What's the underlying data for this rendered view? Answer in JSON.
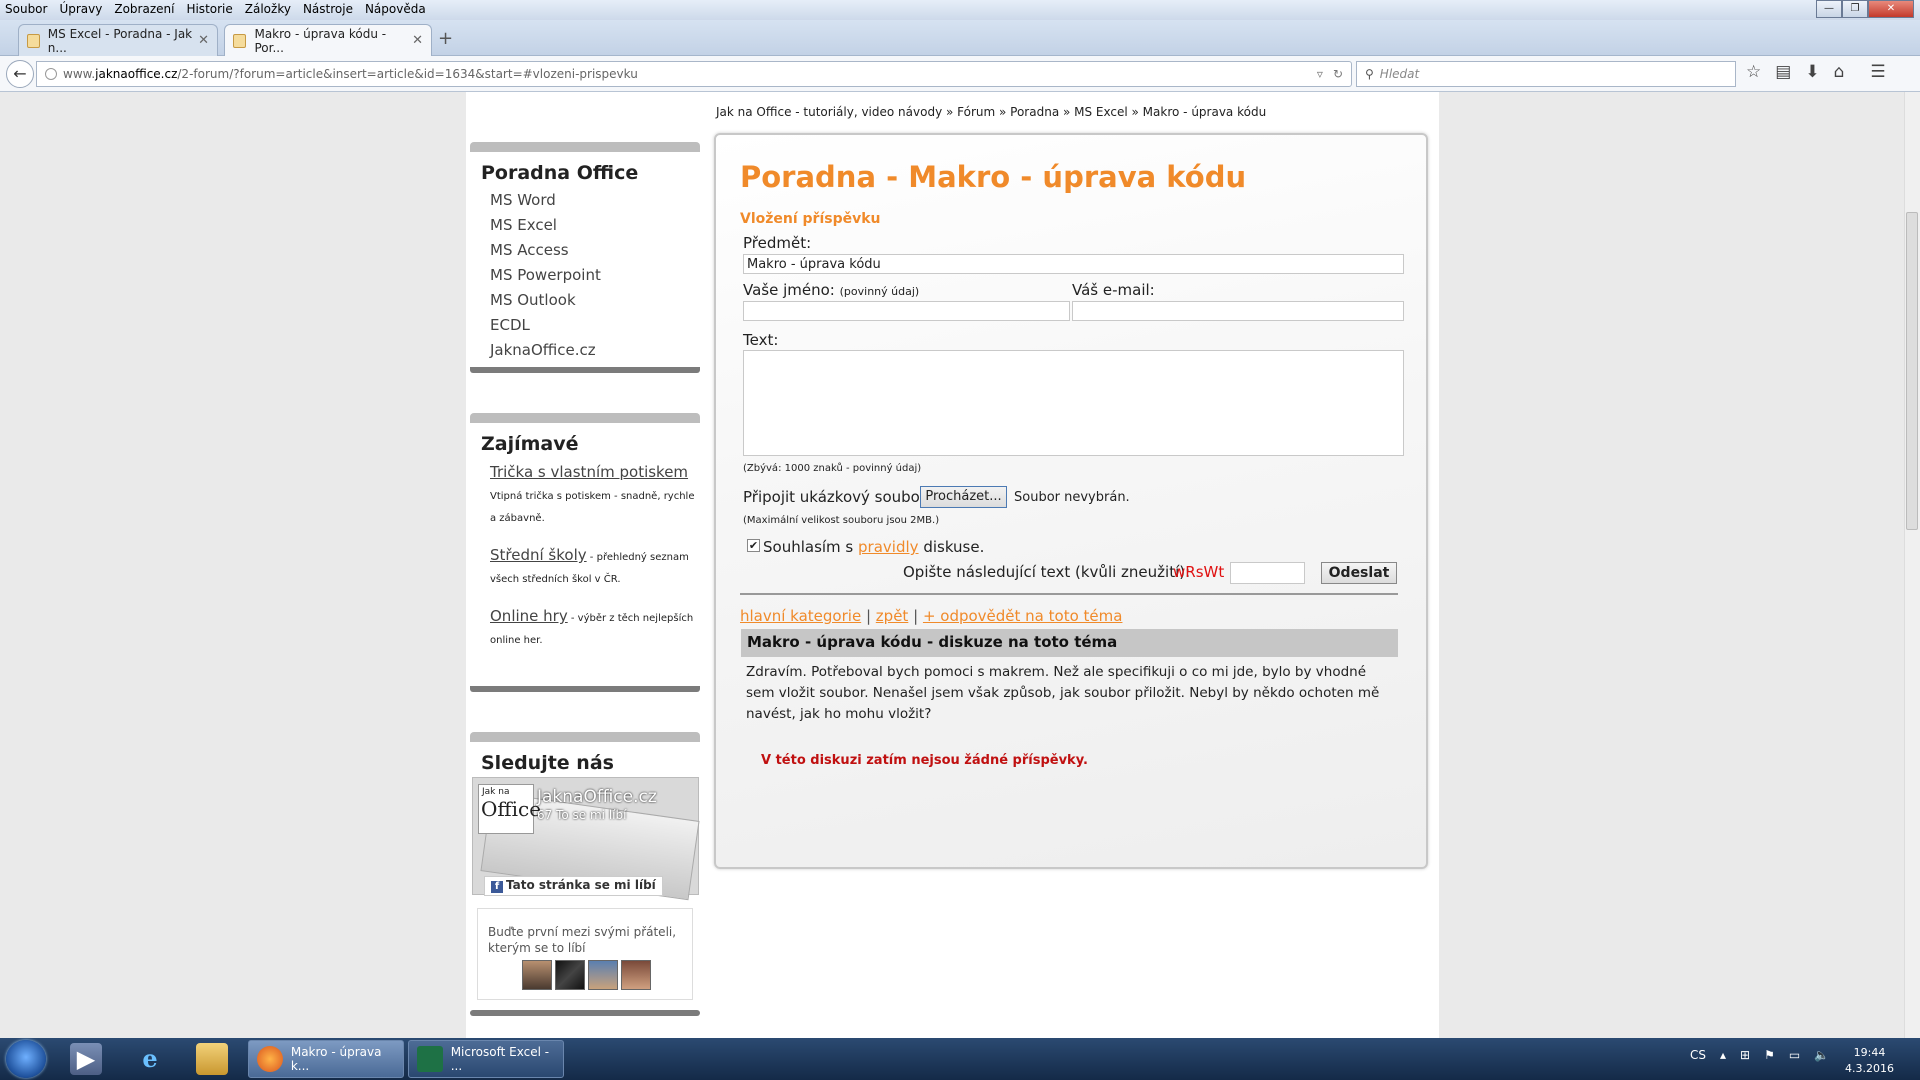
{
  "menu": [
    "Soubor",
    "Úpravy",
    "Zobrazení",
    "Historie",
    "Záložky",
    "Nástroje",
    "Nápověda"
  ],
  "window_buttons": {
    "minimize": "—",
    "maximize": "❐",
    "close": "✕"
  },
  "tabs": [
    {
      "label": "MS Excel - Poradna - Jak n...",
      "close": "✕"
    },
    {
      "label": "Makro - úprava kódu - Por...",
      "close": "✕"
    }
  ],
  "new_tab_symbol": "+",
  "nav": {
    "url_prefix": "www.",
    "url_host": "jaknaoffice.cz",
    "url_path": "/2-forum/?forum=article&insert=article&id=1634&start=#vlozeni-prispevku",
    "search_placeholder": "Hledat"
  },
  "breadcrumb": "Jak na Office - tutoriály, video návody » Fórum » Poradna » MS Excel » Makro - úprava kódu",
  "sidebar": {
    "poradna": {
      "title": "Poradna Office",
      "items": [
        "MS Word",
        "MS Excel",
        "MS Access",
        "MS Powerpoint",
        "MS Outlook",
        "ECDL",
        "JaknaOffice.cz"
      ]
    },
    "zajimave": {
      "title": "Zajímavé",
      "items": [
        {
          "link": "Trička s vlastním potiskem",
          "text": "Vtipná trička s potiskem - snadně, rychle a zábavně."
        },
        {
          "link": "Střední školy",
          "text": " - přehledný seznam všech středních škol v ČR."
        },
        {
          "link": "Online hry",
          "text": " - výběr z těch nejlepších online her."
        }
      ]
    },
    "sledujte": {
      "title": "Sledujte nás",
      "fb_logo_small": "Jak na",
      "fb_logo_big": "Office",
      "fb_page_name": "JaknaOffice.cz",
      "fb_likes": "67 To se mi líbí",
      "fb_like_button": "Tato stránka se mi líbí",
      "fb_friends_text": "Buďte první mezi svými přáteli, kterým se to líbí"
    }
  },
  "main": {
    "title": "Poradna - Makro - úprava kódu",
    "subtitle": "Vložení příspěvku",
    "subject_label": "Předmět:",
    "subject_value": "Makro - úprava kódu",
    "name_label": "Vaše jméno:",
    "name_required": "(povinný údaj)",
    "email_label": "Váš e-mail:",
    "text_label": "Text:",
    "char_note": "(Zbývá: 1000 znaků - povinný údaj)",
    "attach_label": "Připojit ukázkový soubor:",
    "browse_button": "Procházet...",
    "no_file": "Soubor nevybrán.",
    "max_size_note": "(Maximální velikost souboru jsou 2MB.)",
    "agree_prefix": "Souhlasím s",
    "agree_link": "pravidly",
    "agree_suffix": "diskuse.",
    "captcha_label": "Opište následující text (kvůli zneužití):",
    "captcha_code": "wRsWt",
    "send_button": "Odeslat",
    "link_main_category": "hlavní kategorie",
    "link_back": "zpět",
    "link_reply": "+ odpovědět na toto téma",
    "link_sep": "|",
    "topic_title": "Makro - úprava kódu - diskuze na toto téma",
    "topic_text": "Zdravím. Potřeboval bych pomoci s makrem. Než ale specifikuji o co mi jde, bylo by vhodné sem vložit soubor. Nenašel jsem však způsob, jak soubor přiložit. Nebyl by někdo ochoten mě navést, jak ho mohu vložit?",
    "no_posts": "V této diskuzi zatím nejsou žádné příspěvky."
  },
  "taskbar": {
    "tasks": [
      {
        "label": "Makro - úprava k..."
      },
      {
        "label": "Microsoft Excel - ..."
      }
    ],
    "lang": "CS",
    "time": "19:44",
    "date": "4.3.2016"
  }
}
